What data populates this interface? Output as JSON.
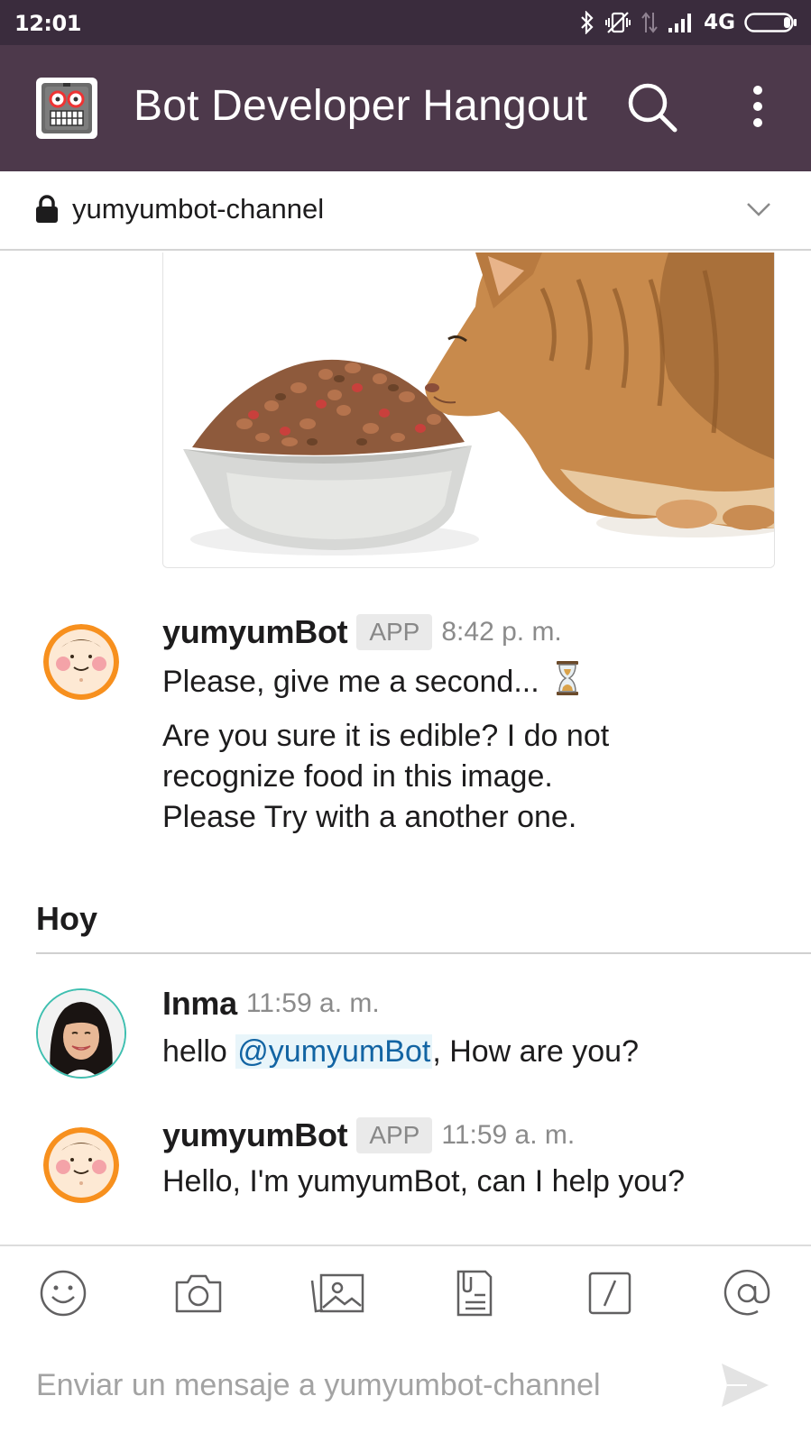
{
  "status_bar": {
    "time": "12:01",
    "network": "4G"
  },
  "header": {
    "team_name": "Bot Developer Hangout",
    "team_logo_icon": "robot-icon",
    "search_icon": "search-icon",
    "more_icon": "more-vertical-icon"
  },
  "channel": {
    "name": "yumyumbot-channel",
    "lock_icon": "lock-icon",
    "chevron_icon": "chevron-down-icon"
  },
  "attachment": {
    "image": "cat-food-photo"
  },
  "messages": [
    {
      "sender": "yumyumBot",
      "badge": "APP",
      "time": "8:42 p. m.",
      "text": "Please, give me a second...",
      "emoji": "hourglass-icon",
      "text2_lines": [
        "Are you sure it is edible? I do not",
        "recognize food in this image.",
        "Please Try with a another one."
      ]
    },
    {
      "sender": "Inma",
      "time": "11:59 a. m.",
      "text_before": "hello",
      "mention": "@yumyumBot",
      "text_after": ", How are you?"
    },
    {
      "sender": "yumyumBot",
      "badge": "APP",
      "time": "11:59 a. m.",
      "text": "Hello, I'm yumyumBot, can I help you?"
    }
  ],
  "day_divider": "Hoy",
  "composer": {
    "placeholder": "Enviar un mensaje a yumyumbot-channel",
    "toolbar_icons": [
      "emoji-icon",
      "camera-icon",
      "image-icon",
      "file-icon",
      "slash-command-icon",
      "mention-icon"
    ],
    "send_icon": "send-icon"
  },
  "colors": {
    "status_bar": "#3a2c3d",
    "app_bar": "#4d394b",
    "mention": "#1264a3",
    "bot_avatar": "#f7901e"
  }
}
